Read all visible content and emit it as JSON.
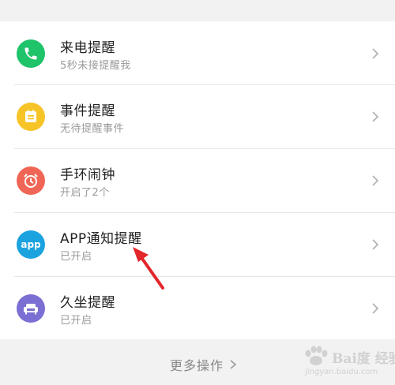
{
  "colors": {
    "phone": "#1fc36a",
    "event": "#f7c428",
    "alarm": "#f06656",
    "app": "#1ba3e0",
    "sedentary": "#7b6fd3",
    "arrow": "#e3262b"
  },
  "items": [
    {
      "title": "来电提醒",
      "subtitle": "5秒未接提醒我",
      "icon": "phone-icon"
    },
    {
      "title": "事件提醒",
      "subtitle": "无待提醒事件",
      "icon": "calendar-icon"
    },
    {
      "title": "手环闹钟",
      "subtitle": "开启了2个",
      "icon": "alarm-clock-icon"
    },
    {
      "title": "APP通知提醒",
      "subtitle": "已开启",
      "icon": "app-icon",
      "icon_text": "app"
    },
    {
      "title": "久坐提醒",
      "subtitle": "已开启",
      "icon": "sofa-icon"
    }
  ],
  "more": {
    "label": "更多操作"
  },
  "watermark": {
    "text": "Bai度 经验",
    "url": "jingyan.baidu.com"
  }
}
